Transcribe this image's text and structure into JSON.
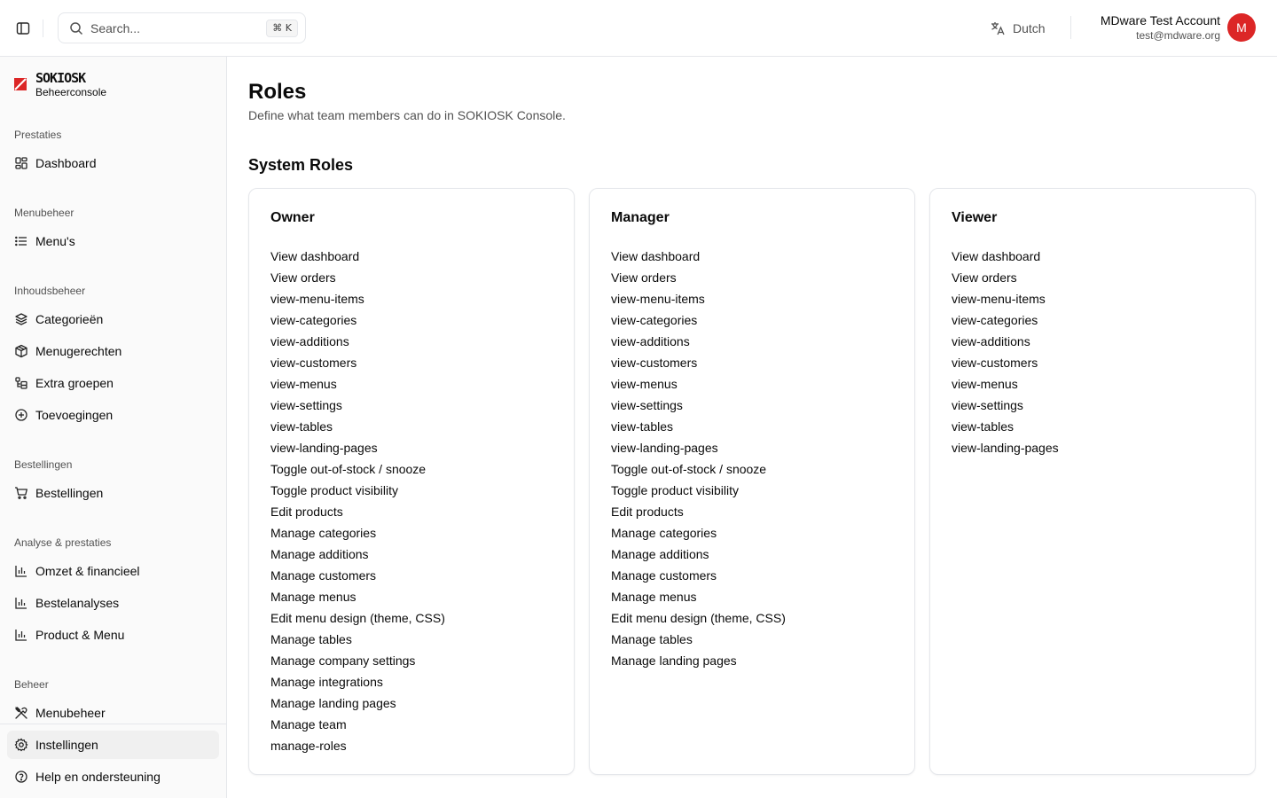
{
  "header": {
    "search_placeholder": "Search...",
    "search_shortcut": "⌘ K",
    "language": "Dutch",
    "user_name": "MDware Test Account",
    "user_email": "test@mdware.org",
    "avatar_initial": "M",
    "avatar_color": "#dc2626"
  },
  "brand": {
    "word": "SOKIOSK",
    "subtitle": "Beheerconsole",
    "accent": "#dc2626"
  },
  "sidebar": {
    "groups": [
      {
        "label": "Prestaties",
        "items": [
          {
            "label": "Dashboard",
            "icon": "dashboard-icon"
          }
        ]
      },
      {
        "label": "Menubeheer",
        "items": [
          {
            "label": "Menu's",
            "icon": "list-icon"
          }
        ]
      },
      {
        "label": "Inhoudsbeheer",
        "items": [
          {
            "label": "Categorieën",
            "icon": "layers-icon"
          },
          {
            "label": "Menugerechten",
            "icon": "package-icon"
          },
          {
            "label": "Extra groepen",
            "icon": "folder-tree-icon"
          },
          {
            "label": "Toevoegingen",
            "icon": "plus-circle-icon"
          }
        ]
      },
      {
        "label": "Bestellingen",
        "items": [
          {
            "label": "Bestellingen",
            "icon": "cart-icon"
          }
        ]
      },
      {
        "label": "Analyse & prestaties",
        "items": [
          {
            "label": "Omzet & financieel",
            "icon": "bar-chart-icon"
          },
          {
            "label": "Bestelanalyses",
            "icon": "bar-chart-icon"
          },
          {
            "label": "Product & Menu",
            "icon": "bar-chart-icon"
          }
        ]
      },
      {
        "label": "Beheer",
        "items": [
          {
            "label": "Menubeheer",
            "icon": "utensils-icon"
          }
        ]
      }
    ],
    "footer": [
      {
        "label": "Instellingen",
        "icon": "gear-icon",
        "active": true
      },
      {
        "label": "Help en ondersteuning",
        "icon": "help-circle-icon"
      }
    ]
  },
  "main": {
    "title": "Roles",
    "subtitle": "Define what team members can do in SOKIOSK Console.",
    "section_title": "System Roles",
    "roles": [
      {
        "name": "Owner",
        "permissions": [
          "View dashboard",
          "View orders",
          "view-menu-items",
          "view-categories",
          "view-additions",
          "view-customers",
          "view-menus",
          "view-settings",
          "view-tables",
          "view-landing-pages",
          "Toggle out-of-stock / snooze",
          "Toggle product visibility",
          "Edit products",
          "Manage categories",
          "Manage additions",
          "Manage customers",
          "Manage menus",
          "Edit menu design (theme, CSS)",
          "Manage tables",
          "Manage company settings",
          "Manage integrations",
          "Manage landing pages",
          "Manage team",
          "manage-roles"
        ]
      },
      {
        "name": "Manager",
        "permissions": [
          "View dashboard",
          "View orders",
          "view-menu-items",
          "view-categories",
          "view-additions",
          "view-customers",
          "view-menus",
          "view-settings",
          "view-tables",
          "view-landing-pages",
          "Toggle out-of-stock / snooze",
          "Toggle product visibility",
          "Edit products",
          "Manage categories",
          "Manage additions",
          "Manage customers",
          "Manage menus",
          "Edit menu design (theme, CSS)",
          "Manage tables",
          "Manage landing pages"
        ]
      },
      {
        "name": "Viewer",
        "permissions": [
          "View dashboard",
          "View orders",
          "view-menu-items",
          "view-categories",
          "view-additions",
          "view-customers",
          "view-menus",
          "view-settings",
          "view-tables",
          "view-landing-pages"
        ]
      }
    ]
  }
}
